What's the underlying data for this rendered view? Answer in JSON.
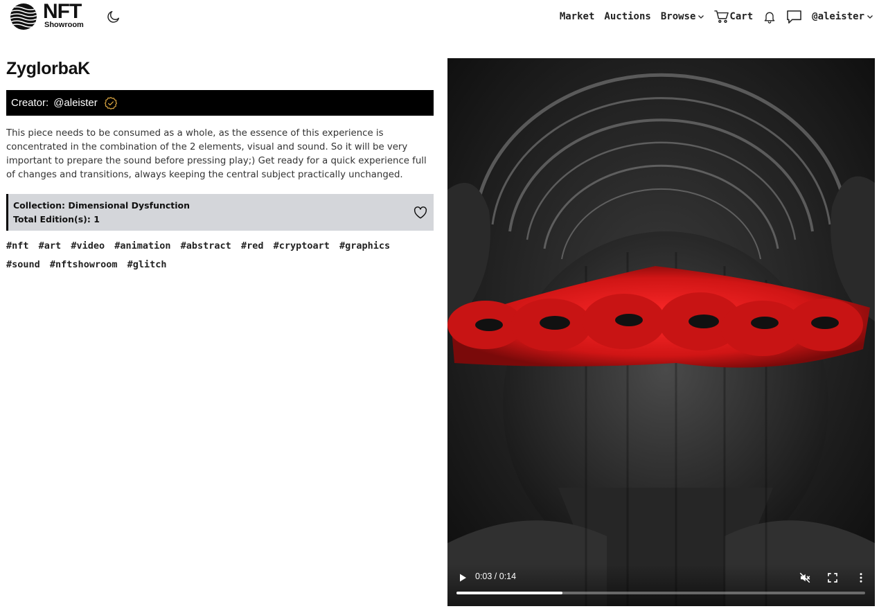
{
  "brand": {
    "logo_main": "NFT",
    "logo_sub": "Showroom"
  },
  "nav": {
    "market": "Market",
    "auctions": "Auctions",
    "browse": "Browse",
    "cart": "Cart",
    "user": "@aleister"
  },
  "icons": {
    "theme": "moon-icon",
    "cart": "cart-icon",
    "notifications": "bell-icon",
    "messages": "chat-bubble-icon",
    "verified": "verified-badge-icon",
    "favorite": "heart-icon"
  },
  "artwork": {
    "title": "ZyglorbaK",
    "creator_label": "Creator:",
    "creator_handle": "@aleister",
    "description": "This piece needs to be consumed as a whole, as the essence of this experience is concentrated in the combination of the 2 elements, visual and sound. So it will be very important to prepare the sound before pressing play;) Get ready for a quick experience full of changes and transitions, always keeping the central subject practically unchanged.",
    "collection": "Collection: Dimensional Dysfunction",
    "editions": "Total Edition(s): 1",
    "tags": [
      "#nft",
      "#art",
      "#video",
      "#animation",
      "#abstract",
      "#red",
      "#cryptoart",
      "#graphics",
      "#sound",
      "#nftshowroom",
      "#glitch"
    ]
  },
  "video": {
    "time": "0:03 / 0:14",
    "progress_fraction": 0.26,
    "muted": true
  },
  "colors": {
    "accent_red": "#e01b1b",
    "creator_bar": "#000000",
    "collection_bg": "#d4d6da",
    "verified_ring": "#d9a441"
  }
}
